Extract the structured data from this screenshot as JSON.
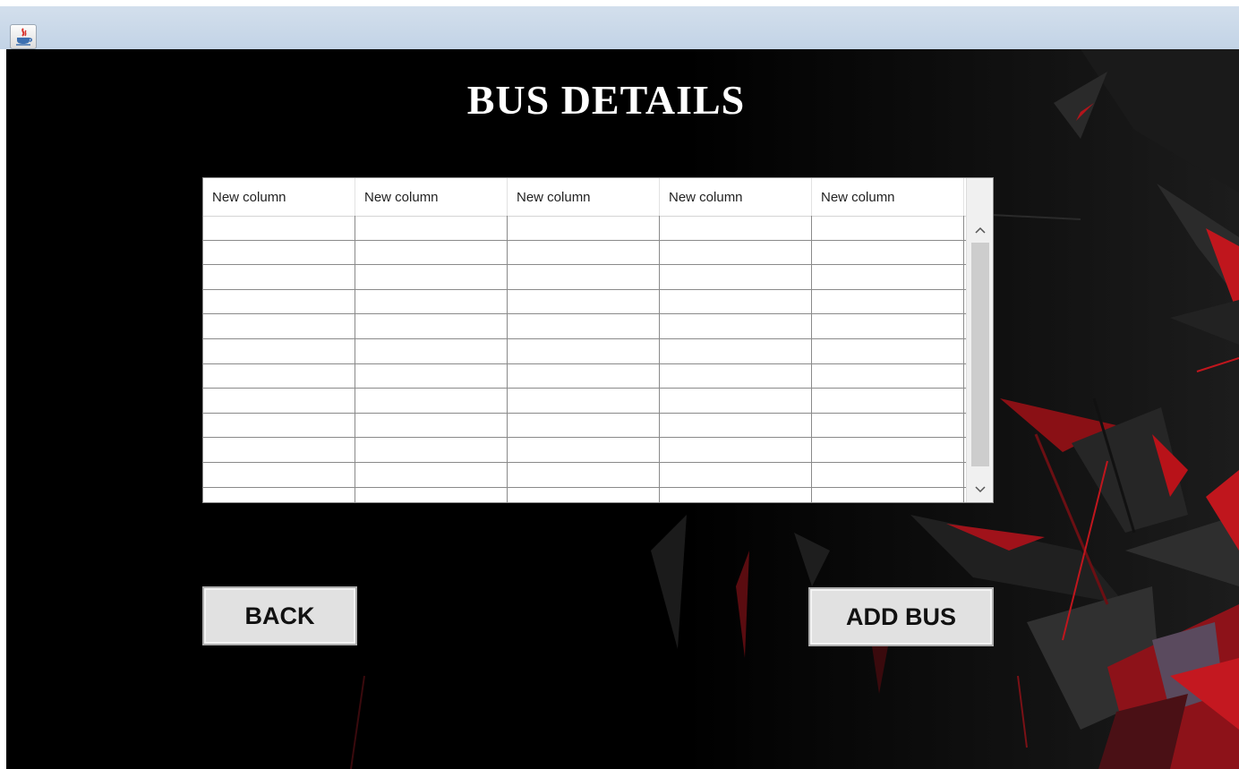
{
  "window": {
    "icon": "java-icon"
  },
  "page": {
    "title": "BUS DETAILS"
  },
  "table": {
    "columns": [
      "New column",
      "New column",
      "New column",
      "New column",
      "New column"
    ],
    "rows": [
      [
        "",
        "",
        "",
        "",
        ""
      ],
      [
        "",
        "",
        "",
        "",
        ""
      ],
      [
        "",
        "",
        "",
        "",
        ""
      ],
      [
        "",
        "",
        "",
        "",
        ""
      ],
      [
        "",
        "",
        "",
        "",
        ""
      ],
      [
        "",
        "",
        "",
        "",
        ""
      ],
      [
        "",
        "",
        "",
        "",
        ""
      ],
      [
        "",
        "",
        "",
        "",
        ""
      ],
      [
        "",
        "",
        "",
        "",
        ""
      ],
      [
        "",
        "",
        "",
        "",
        ""
      ],
      [
        "",
        "",
        "",
        "",
        ""
      ],
      [
        "",
        "",
        "",
        "",
        ""
      ]
    ]
  },
  "buttons": {
    "back_label": "BACK",
    "add_label": "ADD BUS"
  },
  "colors": {
    "background": "#000000",
    "accent": "#c0161d",
    "button_face": "#e1e1e1"
  }
}
